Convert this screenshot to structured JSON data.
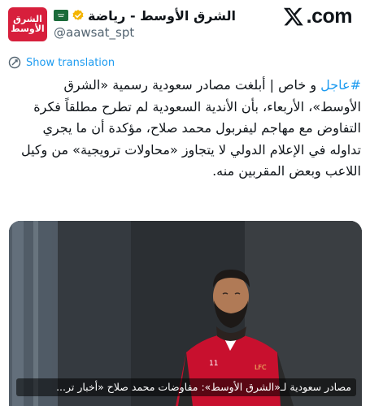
{
  "site": {
    "brand_suffix": ".com",
    "logo_icon": "x-logo-icon"
  },
  "account": {
    "display_name": "الشرق الأوسط - رياضة",
    "handle": "@aawsat_spt",
    "avatar_text_line1": "الشرق",
    "avatar_text_line2": "الأوسط",
    "verified": true,
    "affiliation_badge": "saudi-flag-icon"
  },
  "translation": {
    "label": "Show translation",
    "icon": "translate-icon"
  },
  "tweet": {
    "hashtag": "#عاجل",
    "body": " و خاص | أبلغت مصادر سعودية رسمية «الشرق الأوسط»، الأربعاء، بأن الأندية السعودية لم تطرح مطلقاً فكرة التفاوض مع مهاجم ليفربول محمد صلاح، مؤكدة أن ما يجري تداوله في الإعلام الدولي لا يتجاوز «محاولات ترويجية» من وكيل اللاعب وبعض المقربين منه."
  },
  "media": {
    "caption": "مصادر سعودية لـ«الشرق الأوسط»: مفاوضات محمد صلاح «أخبار تر...",
    "shirt_number": "11",
    "crest_text": "LFC"
  },
  "colors": {
    "accent": "#1d9bf0",
    "text": "#0f1419",
    "secondary": "#536471",
    "avatar_bg": "#d71f3c",
    "verified": "#f4b400",
    "shirt": "#c8102e"
  }
}
